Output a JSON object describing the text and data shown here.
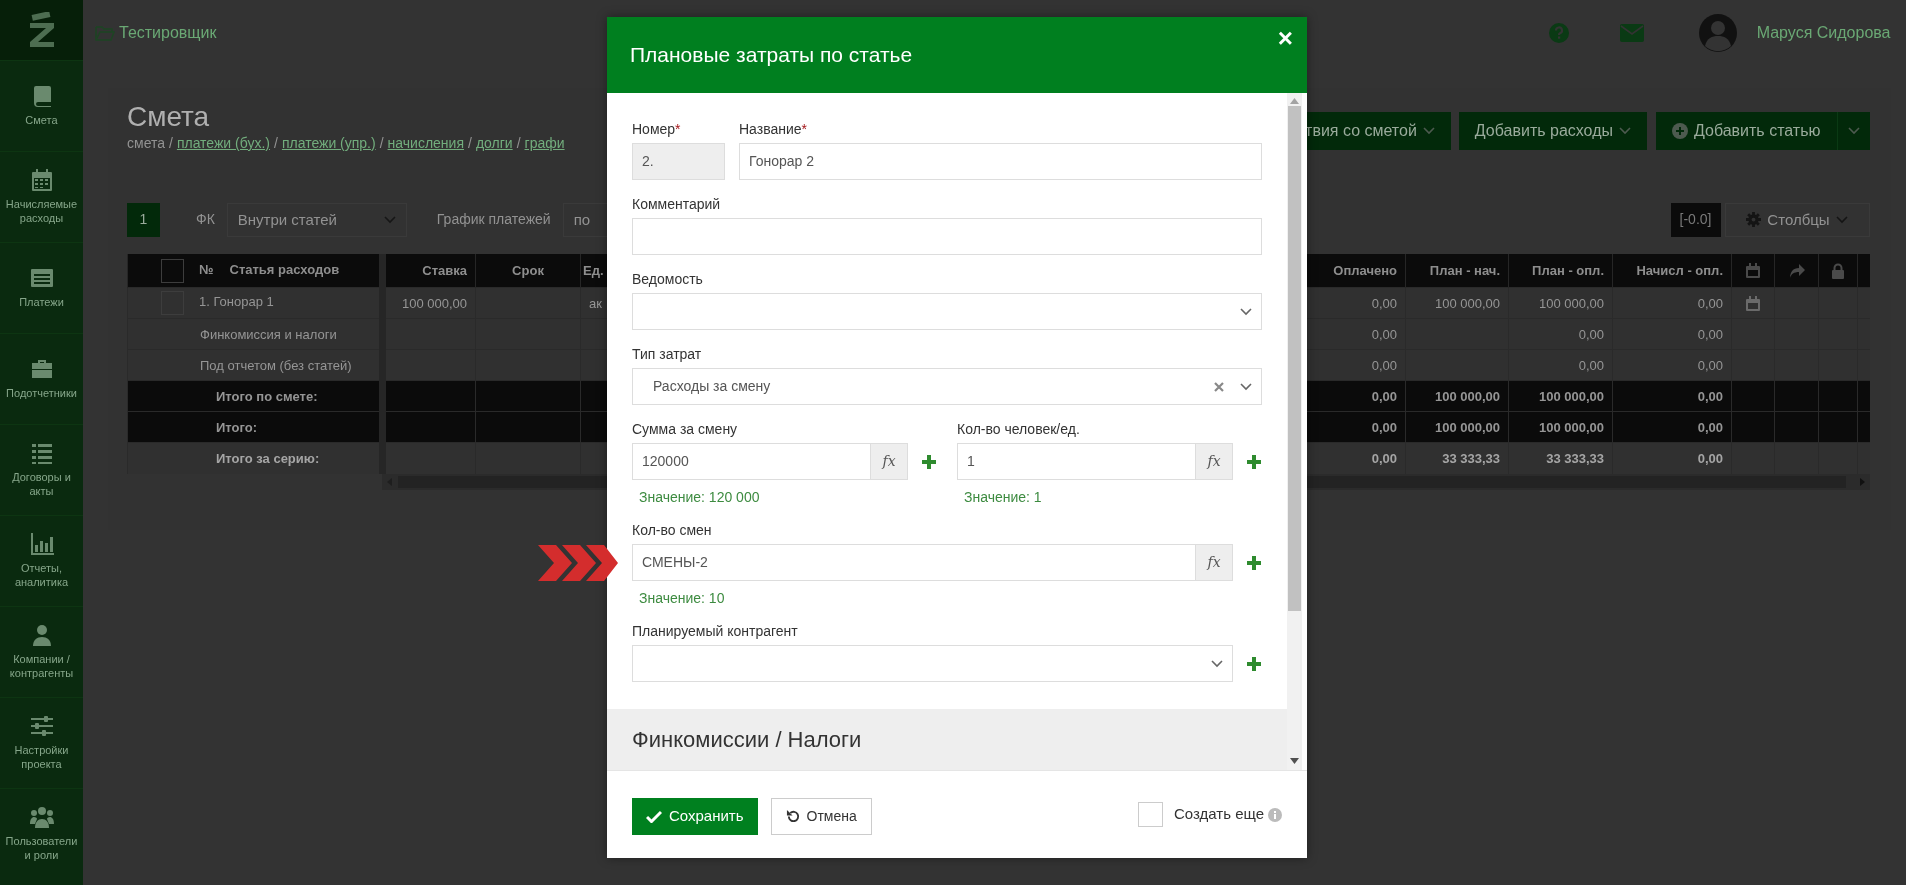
{
  "sidebar": {
    "items": [
      {
        "label": "Смета"
      },
      {
        "label": "Начисляемые расходы"
      },
      {
        "label": "Платежи"
      },
      {
        "label": "Подотчетники"
      },
      {
        "label": "Договоры и акты"
      },
      {
        "label": "Отчеты, аналитика"
      },
      {
        "label": "Компании / контрагенты"
      },
      {
        "label": "Настройки проекта"
      },
      {
        "label": "Пользователи и роли"
      }
    ]
  },
  "header": {
    "project": "Тестировщик",
    "user": "Маруся Сидорова"
  },
  "page": {
    "title": "Смета",
    "separator": "/",
    "breadcrumb": [
      {
        "label": "смета",
        "link": false
      },
      {
        "label": "платежи (бух.)",
        "link": true
      },
      {
        "label": "платежи (упр.)",
        "link": true
      },
      {
        "label": "начисления",
        "link": true
      },
      {
        "label": "долги",
        "link": true
      },
      {
        "label": "графи",
        "link": true
      }
    ]
  },
  "actions": [
    {
      "label": "твия со сметой",
      "kind": "dropdown"
    },
    {
      "label": "Добавить расходы",
      "kind": "dropdown"
    },
    {
      "label": "Добавить статью",
      "kind": "split"
    }
  ],
  "toolbar": {
    "page": "1",
    "fk_label": "ФК",
    "fk_value": "Внутри статей",
    "schedule_label": "График платежей",
    "schedule_value": "по",
    "rounding": "[-0.0]",
    "columns_button": "Столбцы"
  },
  "table": {
    "select_all": {
      "checked": false
    },
    "columns": [
      "№",
      "Статья расходов",
      "Ставка",
      "Срок",
      "Ед.",
      "Оплачено",
      "План - нач.",
      "План - опл.",
      "Начисл - опл."
    ],
    "rows": [
      {
        "kind": "item",
        "checked": false,
        "label": "1. Гонорар 1",
        "rate": "100 000,00",
        "unit": "ак",
        "paid": "0,00",
        "plan_accrued": "100 000,00",
        "plan_paid": "100 000,00",
        "accrued_paid": "0,00",
        "calendar": true
      },
      {
        "kind": "plain",
        "label": "Финкомиссия и налоги",
        "paid": "0,00",
        "plan_paid": "0,00",
        "accrued_paid": "0,00",
        "calendar": false
      },
      {
        "kind": "plain",
        "label": "Под отчетом (без статей)",
        "paid": "0,00",
        "plan_paid": "0,00",
        "accrued_paid": "0,00",
        "calendar": false
      },
      {
        "kind": "total",
        "label": "Итого по смете:",
        "paid": "0,00",
        "plan_accrued": "100 000,00",
        "plan_paid": "100 000,00",
        "accrued_paid": "0,00",
        "calendar": false
      },
      {
        "kind": "total",
        "label": "Итого:",
        "paid": "0,00",
        "plan_accrued": "100 000,00",
        "plan_paid": "100 000,00",
        "accrued_paid": "0,00",
        "calendar": false
      },
      {
        "kind": "series",
        "label": "Итого за серию:",
        "paid": "0,00",
        "plan_accrued": "33 333,33",
        "plan_paid": "33 333,33",
        "accrued_paid": "0,00",
        "calendar": false
      }
    ]
  },
  "modal": {
    "title": "Плановые затраты по статье",
    "close": "×",
    "required_mark": "*",
    "rows": [
      [
        {
          "kind": "text",
          "label": "Номер",
          "required": true,
          "disabled": true,
          "value": "2.",
          "add": false
        },
        {
          "kind": "text",
          "label": "Название",
          "required": true,
          "disabled": false,
          "value": "Гонорар 2",
          "add": false
        }
      ],
      [
        {
          "kind": "text",
          "label": "Комментарий",
          "required": false,
          "disabled": false,
          "add": false
        }
      ],
      [
        {
          "kind": "select",
          "label": "Ведомость",
          "required": false,
          "clearable": false,
          "add": false
        }
      ],
      [
        {
          "kind": "select",
          "label": "Тип затрат",
          "required": false,
          "value": "Расходы за смену",
          "clearable": true,
          "add": false
        }
      ],
      [
        {
          "kind": "formula",
          "label": "Сумма за смену",
          "required": false,
          "value": "120000",
          "addon": "fx",
          "result": "Значение: 120 000",
          "add": true
        },
        {
          "kind": "formula",
          "label": "Кол-во человек/ед.",
          "required": false,
          "value": "1",
          "addon": "fx",
          "result": "Значение: 1",
          "add": true
        }
      ],
      [
        {
          "kind": "formula",
          "label": "Кол-во смен",
          "required": false,
          "value": "СМЕНЫ-2",
          "addon": "fx",
          "result": "Значение: 10",
          "add": true,
          "pointer": true
        }
      ],
      [
        {
          "kind": "select",
          "label": "Планируемый контрагент",
          "required": false,
          "clearable": false,
          "add": true
        }
      ]
    ],
    "section": "Финкомиссии / Налоги",
    "save": "Сохранить",
    "cancel": "Отмена",
    "create_more": {
      "label": "Создать еще",
      "checked": false
    }
  }
}
